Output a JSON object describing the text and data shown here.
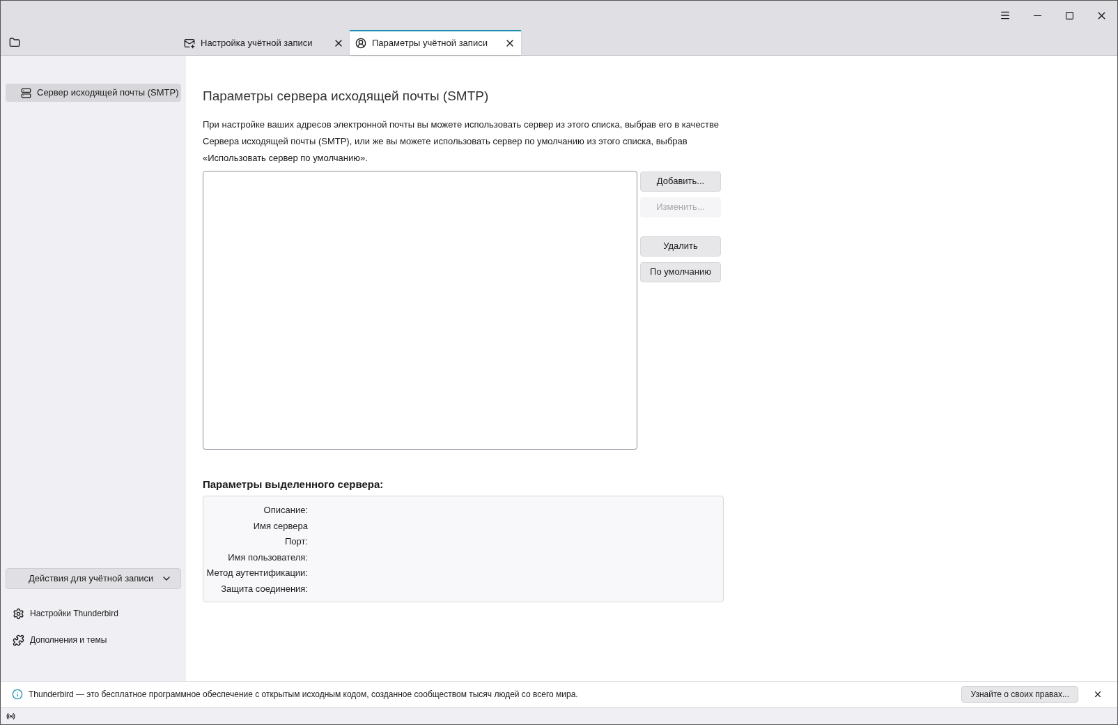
{
  "tabs": [
    {
      "label": "Настройка учётной записи",
      "kind": "mail",
      "selected": false
    },
    {
      "label": "Параметры учётной записи",
      "kind": "account",
      "selected": true
    }
  ],
  "sidebar": {
    "items": [
      {
        "label": "Сервер исходящей почты (SMTP)",
        "selected": true
      }
    ],
    "actions_button": "Действия для учётной записи",
    "links": [
      {
        "label": "Настройки Thunderbird",
        "kind": "settings"
      },
      {
        "label": "Дополнения и темы",
        "kind": "addons"
      }
    ]
  },
  "main": {
    "title": "Параметры сервера исходящей почты (SMTP)",
    "description": "При настройке ваших адресов электронной почты вы можете использовать сервер из этого списка, выбрав его в качестве Сервера исходящей почты (SMTP), или же вы можете использовать сервер по умолчанию из этого списка, выбрав «Использовать сервер по умолчанию».",
    "buttons": [
      {
        "label": "Добавить...",
        "disabled": false
      },
      {
        "label": "Изменить...",
        "disabled": true
      },
      {
        "label": "Удалить",
        "disabled": false
      },
      {
        "label": "По умолчанию",
        "disabled": false
      }
    ],
    "details_title": "Параметры выделенного сервера:",
    "details": [
      "Описание:",
      "Имя сервера",
      "Порт:",
      "Имя пользователя:",
      "Метод аутентификации:",
      "Защита соединения:"
    ]
  },
  "notification": {
    "text": "Thunderbird — это бесплатное программное обеспечение с открытым исходным кодом, созданное сообществом тысяч людей со всего мира.",
    "button": "Узнайте о своих правах..."
  }
}
